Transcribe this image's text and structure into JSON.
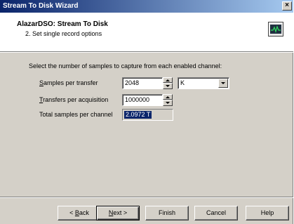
{
  "window": {
    "title": "Stream To Disk Wizard",
    "close_glyph": "×"
  },
  "header": {
    "title": "AlazarDSO: Stream To Disk",
    "subtitle": "2. Set single record options",
    "icon": "oscilloscope-icon"
  },
  "content": {
    "instruction": "Select the number of samples to capture from each enabled channel:",
    "samples_per_transfer": {
      "label_mnemonic": "S",
      "label_rest": "amples per transfer",
      "value": "2048",
      "unit": "K"
    },
    "transfers_per_acquisition": {
      "label_mnemonic": "T",
      "label_rest": "ransfers per acquisition",
      "value": "1000000"
    },
    "total_samples": {
      "label": "Total samples per channel",
      "value": "2.0972 T"
    }
  },
  "buttons": {
    "back": {
      "prefix": "< ",
      "mnemonic": "B",
      "rest": "ack"
    },
    "next": {
      "mnemonic": "N",
      "rest": "ext >"
    },
    "finish": "Finish",
    "cancel": "Cancel",
    "help": "Help"
  },
  "colors": {
    "titlebar_start": "#0a246a",
    "titlebar_end": "#a6caf0",
    "dialog_face": "#d4d0c8",
    "selection": "#0a246a"
  }
}
